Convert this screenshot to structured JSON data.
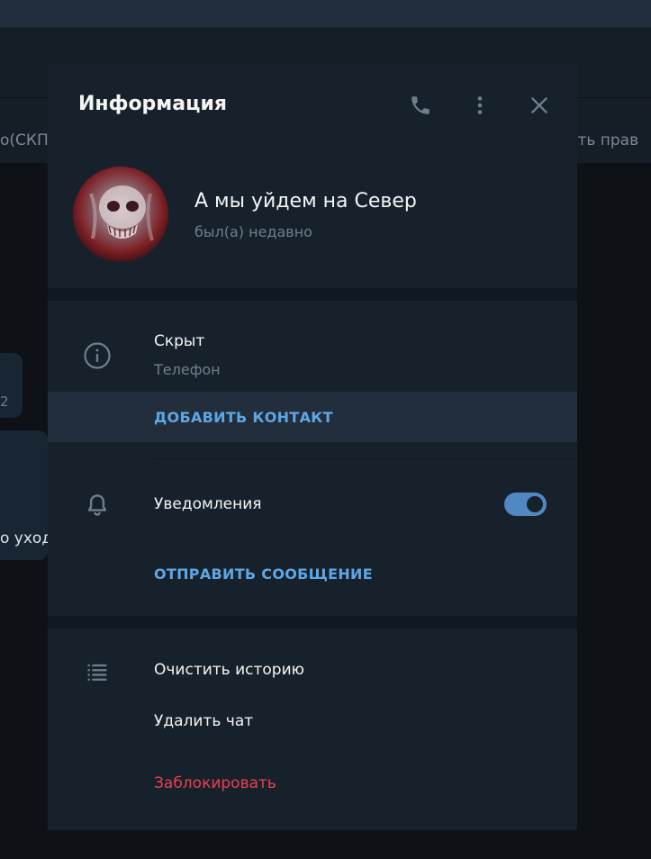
{
  "background": {
    "left_text": "о(СКПЧ",
    "right_text": "оить прав",
    "bubble_number": "2",
    "bubble_text": "о уход"
  },
  "modal": {
    "title": "Информация",
    "header_icons": [
      "phone-icon",
      "more-vertical-icon",
      "close-icon"
    ],
    "profile": {
      "name": "А мы уйдем на Север",
      "status": "был(а) недавно"
    },
    "info": {
      "value": "Скрыт",
      "label": "Телефон",
      "add_contact": "ДОБАВИТЬ КОНТАКТ"
    },
    "notifications": {
      "label": "Уведомления",
      "enabled": true,
      "send_message": "ОТПРАВИТЬ СООБЩЕНИЕ"
    },
    "actions": {
      "clear_history": "Очистить историю",
      "delete_chat": "Удалить чат",
      "block": "Заблокировать"
    }
  },
  "colors": {
    "accent": "#5fa6e6",
    "toggle": "#5288c1",
    "danger": "#e9414d",
    "panel": "#17212b"
  }
}
